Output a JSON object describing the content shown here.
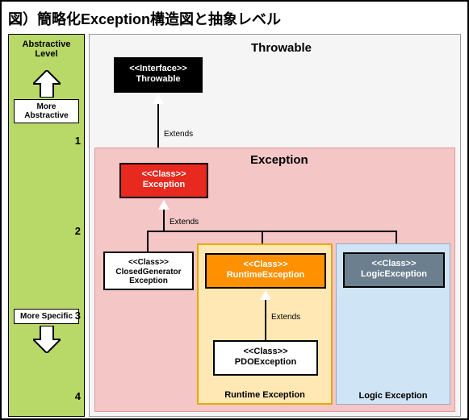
{
  "title": "図）簡略化Exception構造図と抽象レベル",
  "sidebar": {
    "heading": "Abstractive Level",
    "labelTop": "More Abstractive",
    "labelBottom": "More Specific",
    "levels": {
      "l1": "1",
      "l2": "2",
      "l3": "3",
      "l4": "4"
    }
  },
  "regions": {
    "throwable": "Throwable",
    "exception": "Exception",
    "runtime": "Runtime Exception",
    "logic": "Logic Exception"
  },
  "boxes": {
    "throwable": {
      "stereo": "<<Interface>>",
      "name": "Throwable"
    },
    "exception": {
      "stereo": "<<Class>>",
      "name": "Exception"
    },
    "closed": {
      "stereo": "<<Class>>",
      "name": "ClosedGenerator Exception"
    },
    "runtime": {
      "stereo": "<<Class>>",
      "name": "RuntimeException"
    },
    "logic": {
      "stereo": "<<Class>>",
      "name": "LogicException"
    },
    "pdo": {
      "stereo": "<<Class>>",
      "name": "PDOException"
    }
  },
  "relations": {
    "extends": "Extends"
  },
  "chart_data": {
    "type": "diagram",
    "title": "簡略化Exception構造図と抽象レベル",
    "abstraction_levels": [
      1,
      2,
      3,
      4
    ],
    "nodes": [
      {
        "id": "Throwable",
        "kind": "Interface",
        "level": 1
      },
      {
        "id": "Exception",
        "kind": "Class",
        "level": 2,
        "extends": "Throwable"
      },
      {
        "id": "ClosedGeneratorException",
        "kind": "Class",
        "level": 3,
        "extends": "Exception"
      },
      {
        "id": "RuntimeException",
        "kind": "Class",
        "level": 3,
        "extends": "Exception",
        "group": "Runtime Exception"
      },
      {
        "id": "LogicException",
        "kind": "Class",
        "level": 3,
        "extends": "Exception",
        "group": "Logic Exception"
      },
      {
        "id": "PDOException",
        "kind": "Class",
        "level": 4,
        "extends": "RuntimeException",
        "group": "Runtime Exception"
      }
    ],
    "groups": [
      "Throwable",
      "Exception",
      "Runtime Exception",
      "Logic Exception"
    ],
    "axis": {
      "top": "More Abstractive",
      "bottom": "More Specific"
    }
  }
}
